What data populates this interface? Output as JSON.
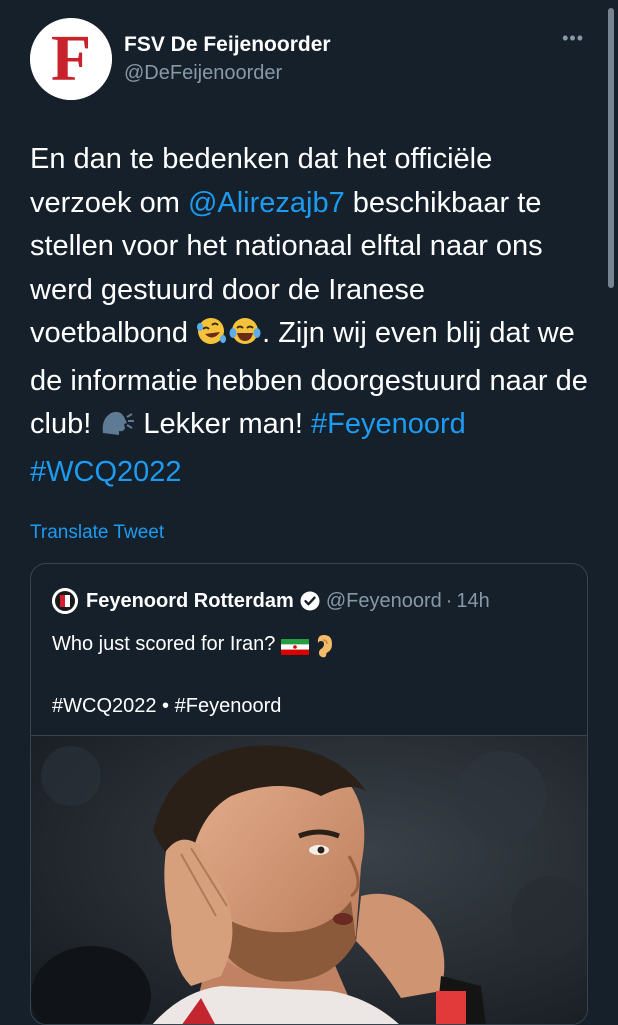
{
  "author": {
    "display_name": "FSV De Feijenoorder",
    "handle": "@DeFeijenoorder",
    "avatar_letter": "F",
    "avatar_color": "#c8232c"
  },
  "more_icon": "more-horizontal-icon",
  "tweet": {
    "text_1": "En dan te bedenken dat het officiële verzoek om ",
    "mention": "@Alirezajb7",
    "text_2": " beschikbaar te stellen voor het nationaal elftal naar ons werd gestuurd door de Iranese voetbalbond ",
    "emoji_1": "rolling-on-floor-laughing-emoji",
    "emoji_2": "tears-of-joy-emoji",
    "text_3": ". Zijn wij even blij dat we de informatie hebben doorgestuurd naar de club! ",
    "emoji_3": "speaking-head-emoji",
    "text_4": " Lekker man! ",
    "hashtag_1": "#Feyenoord",
    "hashtag_2": "#WCQ2022"
  },
  "translate_label": "Translate Tweet",
  "quote": {
    "display_name": "Feyenoord Rotterdam",
    "verified_icon": "verified-badge-icon",
    "handle": "@Feyenoord",
    "separator": "·",
    "time": "14h",
    "text": "Who just scored for Iran? ",
    "emoji_flag": "iran-flag-emoji",
    "emoji_ear": "ear-emoji",
    "tags": "#WCQ2022 • #Feyenoord",
    "media": "photo-player-hand-to-ear"
  },
  "colors": {
    "background": "#15202b",
    "link": "#1d9bf0",
    "secondary_text": "#8899a6",
    "border": "#38444d"
  }
}
